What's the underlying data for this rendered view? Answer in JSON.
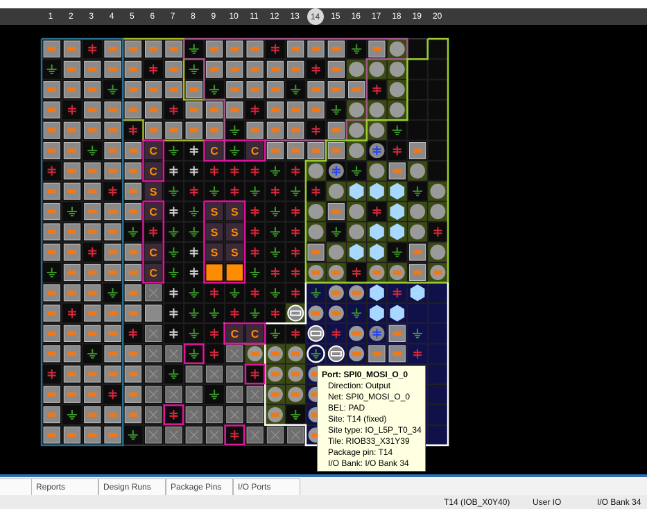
{
  "ruler": {
    "columns": [
      "1",
      "2",
      "3",
      "4",
      "5",
      "6",
      "7",
      "8",
      "9",
      "10",
      "11",
      "12",
      "13",
      "14",
      "15",
      "16",
      "17",
      "18",
      "19",
      "20"
    ],
    "selected": "14"
  },
  "package": {
    "grid": [
      "OOXOOOOGOOOXOOOGOc",
      "GOOOOXOGOOOOOXOccc",
      "OOOGOOOOGOOOGOOOXc",
      "OXOOOOXOOOXOOOGccc",
      "OOOOXOOOOGOOOXOccG",
      "OOGOOCGLCGCOOOOcBXO",
      "XOOOOCLLXXXGXcBGcOc",
      "OOOXOSGXGXGXGXchhhGc",
      "OGOOOCLGSSXGXcOcXhcc",
      "OOOOGXGGSSXGXcGchhcX",
      "OOXOOCGLSSXGXOchhGOc",
      "GOOOOCGLFFGXXccXccOc",
      "OOOGOxLGXGXGXGcchXh",
      "OXOOOsLGGXGXWccGhh",
      "OOOOXxLGXCCGXWXcBOG",
      "OOGOOxxGXxcccGWcOOX",
      "XOOOOxGxxxXcccc",
      "OOOXOxxxGxxcccc",
      "OGOOOxXxxxxcGcc",
      "OOOOGxxxxXxxxccc"
    ],
    "region_colors": {
      "config": "#e0149e",
      "spi": "#e0149e",
      "bank_olive": "#a5b82a",
      "bank_purple": "#a05a8a",
      "bank_green": "#9acd32",
      "bank_blue": "#ffffff",
      "bank_teal": "#2a6e8e"
    }
  },
  "tooltip": {
    "title": "Port: SPI0_MOSI_O_0",
    "lines": [
      "Direction: Output",
      "Net: SPI0_MOSI_O_0",
      "BEL: PAD",
      "Site: T14 (fixed)",
      "Site type: IO_L5P_T0_34",
      "Tile: RIOB33_X31Y39",
      "Package pin: T14",
      "I/O Bank: I/O Bank 34"
    ]
  },
  "tabs": [
    {
      "label": "Reports"
    },
    {
      "label": "Design Runs"
    },
    {
      "label": "Package Pins"
    },
    {
      "label": "I/O Ports"
    }
  ],
  "status": {
    "site": "T14 (IOB_X0Y40)",
    "type": "User IO",
    "bank": "I/O Bank 34"
  },
  "colors": {
    "accent_blue": "#2f6db5",
    "io_orange": "#f07818",
    "power_red": "#d8283c",
    "ground_green": "#3c9a2a",
    "config_orange": "#ff8c00",
    "hex_light_blue": "#a8d8ff"
  }
}
